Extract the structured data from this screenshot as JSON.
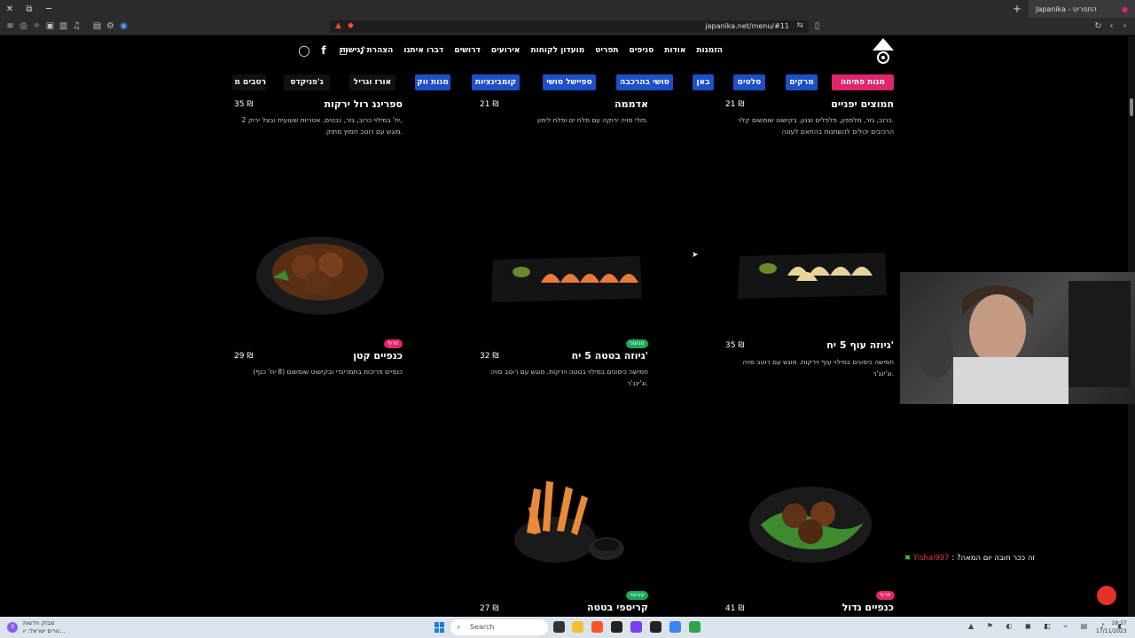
{
  "browser": {
    "tab_title": "Japanika - התפריט",
    "url": "japanika.net/menu/#11"
  },
  "nav": {
    "links": [
      "הזמנות",
      "אודות",
      "סניפים",
      "תפריט",
      "מועדון לקוחות",
      "אירועים",
      "דרושים",
      "דברו איתנו",
      "הצהרת נגישות"
    ]
  },
  "categories": [
    {
      "label": "מנות פתיחה",
      "state": "active"
    },
    {
      "label": "מרקים",
      "state": "blue"
    },
    {
      "label": "סלטים",
      "state": "blue"
    },
    {
      "label": "באן",
      "state": "blue"
    },
    {
      "label": "סושי בהרכבה",
      "state": "blue"
    },
    {
      "label": "ספיישל סושי",
      "state": "blue"
    },
    {
      "label": "קומבינציות",
      "state": "blue"
    },
    {
      "label": "מנות ווק",
      "state": "blue"
    },
    {
      "label": "אורז וגריל",
      "state": "plain"
    },
    {
      "label": "ג'פניקדס",
      "state": "plain"
    },
    {
      "label": "רטבים מ",
      "state": "plain"
    }
  ],
  "menu": {
    "row1": [
      {
        "title": "חמוצים יפניים",
        "price": "21 ₪",
        "desc1": "כרוב, גזר, מלפפון, פלפלים וצנון, בקישוט שומשום קלוי.",
        "desc2": "הרכיבים יכולים להשתנות בהתאם לעונה"
      },
      {
        "title": "אדממה",
        "price": "21 ₪",
        "desc1": "פולי סויה ירוקה עם מלח ים ופלח לימון.",
        "desc2": ""
      },
      {
        "title": "ספרינג רול ירקות",
        "price": "35 ₪",
        "desc1": "2 יח' במילוי כרוב, גזר, נבטים, אטריות שעועית ובצל ירוק,",
        "desc2": "מוגש עם רוטב חמוץ מתוק."
      }
    ],
    "row2": [
      {
        "title": "גיוזה עוף 5 יח'",
        "price": "35 ₪",
        "desc1": "חמישה כיסונים במילוי עוף וירקות. מוגש עם רוטב סויה",
        "desc2": "וג'ינג'ר.",
        "badge": ""
      },
      {
        "title": "גיוזה בטטה 5 יח'",
        "price": "32 ₪",
        "desc1": "חמישה כיסונים במילוי בטטה וירקות. מוגש עם רוטב סויה",
        "desc2": "וג'ינג'ר.",
        "badge": "טבעוני"
      },
      {
        "title": "כנפיים קטן",
        "price": "29 ₪",
        "desc1": "כנפיים פריכות בתמרינדי ובקישוט שומשום (8 יח' כנף)",
        "desc2": "",
        "badge": "חריף"
      }
    ],
    "row3": [
      {
        "title": "כנפיים גדול",
        "price": "41 ₪",
        "badge": "חריף"
      },
      {
        "title": "קריספי בטטה",
        "price": "27 ₪",
        "badge": "טבעוני"
      }
    ]
  },
  "chat": {
    "username": "Yishai997",
    "message": "?זה ככר חובה יום המאה"
  },
  "taskbar": {
    "weather_line1": "מבזק חדשות",
    "weather_line2": "נורים ישראל: יו...",
    "search_placeholder": "Search",
    "time": "18:37",
    "date": "17/11/2023",
    "notif_count": "3"
  },
  "colors": {
    "active_category": "#e0256b",
    "category_blue": "#1d4fc7",
    "vegan_badge": "#18a85a",
    "spicy_badge": "#e0256b"
  }
}
